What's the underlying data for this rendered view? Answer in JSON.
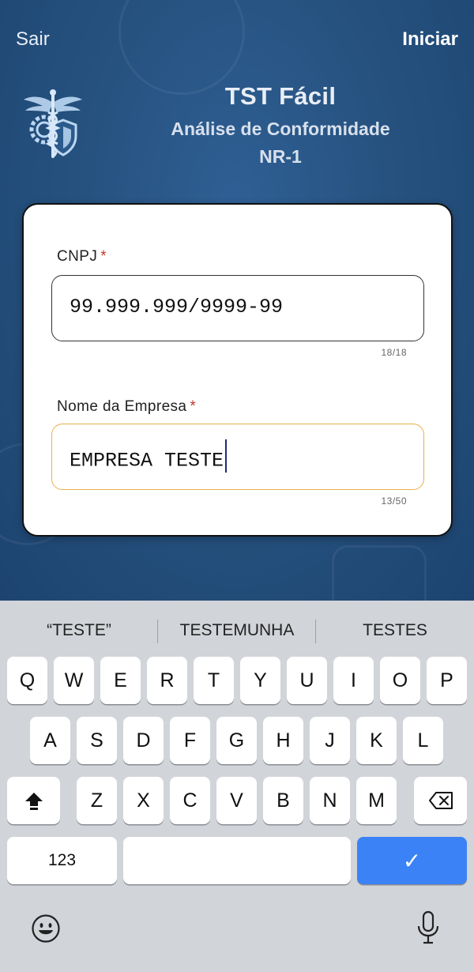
{
  "header": {
    "left_button": "Sair",
    "right_button": "Iniciar",
    "title": "TST Fácil",
    "subtitle": "Análise de Conformidade",
    "subtitle2": "NR-1"
  },
  "form": {
    "cnpj": {
      "label": "CNPJ",
      "required_mark": "*",
      "value": "99.999.999/9999-99",
      "counter": "18/18"
    },
    "company": {
      "label": "Nome da Empresa",
      "required_mark": "*",
      "value": "EMPRESA TESTE",
      "counter": "13/50"
    }
  },
  "keyboard": {
    "suggestions": [
      "“TESTE”",
      "TESTEMUNHA",
      "TESTES"
    ],
    "row1": [
      "Q",
      "W",
      "E",
      "R",
      "T",
      "Y",
      "U",
      "I",
      "O",
      "P"
    ],
    "row2": [
      "A",
      "S",
      "D",
      "F",
      "G",
      "H",
      "J",
      "K",
      "L"
    ],
    "row3": [
      "Z",
      "X",
      "C",
      "V",
      "B",
      "N",
      "M"
    ],
    "numbers_key": "123",
    "done_key": "✓"
  },
  "colors": {
    "header_bg": "#26527f",
    "focus_border": "#e8b04a",
    "required": "#c0392b",
    "done_key": "#3b82f6"
  }
}
